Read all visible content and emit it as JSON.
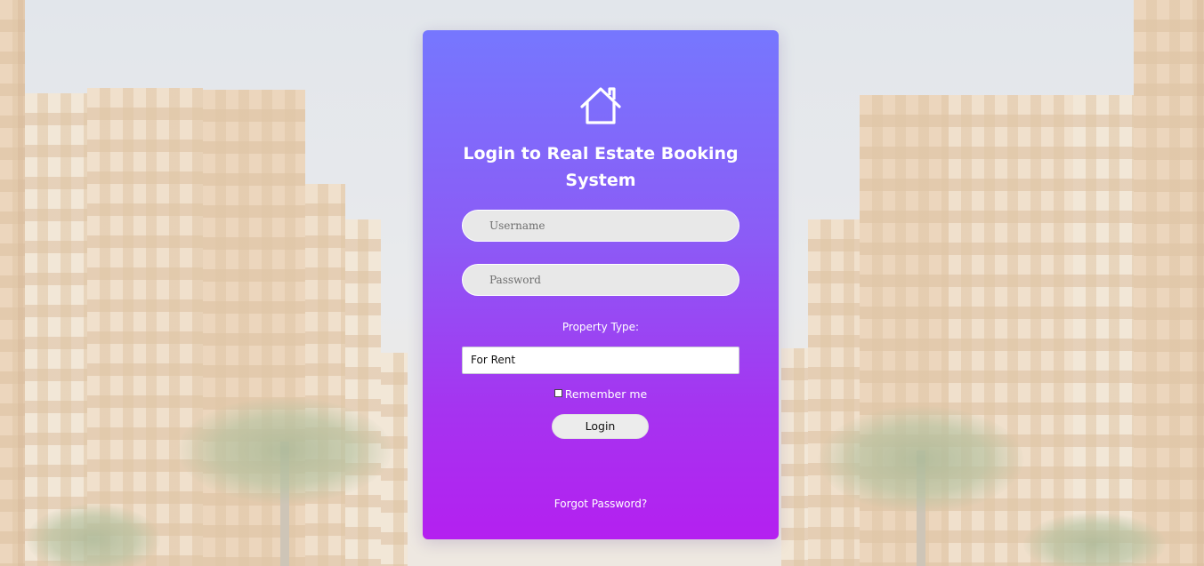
{
  "page": {
    "title": "Login to Real Estate Booking System"
  },
  "form": {
    "username_placeholder": "Username",
    "password_placeholder": "Password",
    "property_type_label": "Property Type:",
    "property_type_selected": "For Rent",
    "remember_label": "Remember me",
    "remember_checked": false,
    "login_label": "Login",
    "forgot_label": "Forgot Password?"
  },
  "icons": {
    "logo": "house-icon"
  },
  "colors": {
    "card_top": "#7677fe",
    "card_bottom": "#b420f0",
    "input_bg": "#e8e8e8"
  }
}
